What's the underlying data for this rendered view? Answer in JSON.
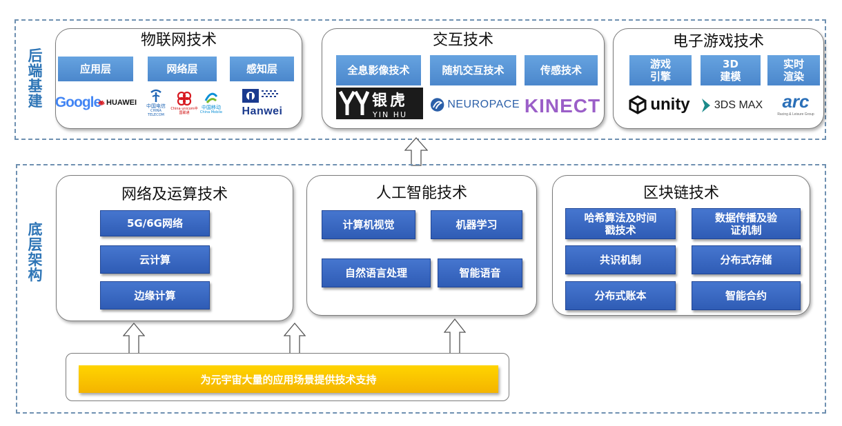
{
  "frontend": {
    "label": "后端基建",
    "iot": {
      "title": "物联网技术",
      "tags": [
        "应用层",
        "网络层",
        "感知层"
      ],
      "logos": {
        "google": "Google",
        "huawei": "HUAWEI",
        "telecom": "中国电信",
        "telecom_en": "CHINA TELECOM",
        "unicom": "China unicom中国联通",
        "mobile": "中国移动",
        "mobile_en": "China Mobile",
        "hanwei": "Hanwei"
      }
    },
    "interaction": {
      "title": "交互技术",
      "tags": [
        "全息影像技术",
        "随机交互技术",
        "传感技术"
      ],
      "logos": {
        "yinhu_cn": "银虎",
        "yinhu_en": "YIN HU",
        "neuropace": "NEUROPACE",
        "kinect": "KINECT"
      }
    },
    "game": {
      "title": "电子游戏技术",
      "tags": [
        "游戏引擎",
        "3D建模",
        "实时渲染"
      ],
      "logos": {
        "unity": "unity",
        "max": "3DS MAX",
        "arc": "arc",
        "arc_sub": "Racing & Leisure Group"
      }
    }
  },
  "backend": {
    "label": "底层架构",
    "network": {
      "title": "网络及运算技术",
      "items": [
        "5G/6G网络",
        "云计算",
        "边缘计算"
      ]
    },
    "ai": {
      "title": "人工智能技术",
      "items": [
        "计算机视觉",
        "机器学习",
        "自然语言处理",
        "智能语音"
      ]
    },
    "blockchain": {
      "title": "区块链技术",
      "items": [
        "哈希算法及时间戳技术",
        "数据传播及验证机制",
        "共识机制",
        "分布式存储",
        "分布式账本",
        "智能合约"
      ]
    },
    "support": "为元宇宙大量的应用场景提供技术支持"
  },
  "colors": {
    "region_border": "#6d8fb0",
    "side_label": "#2e75b6",
    "tag": "#5b97d8",
    "box": "#3a69c3",
    "bar": "#f8c300"
  }
}
